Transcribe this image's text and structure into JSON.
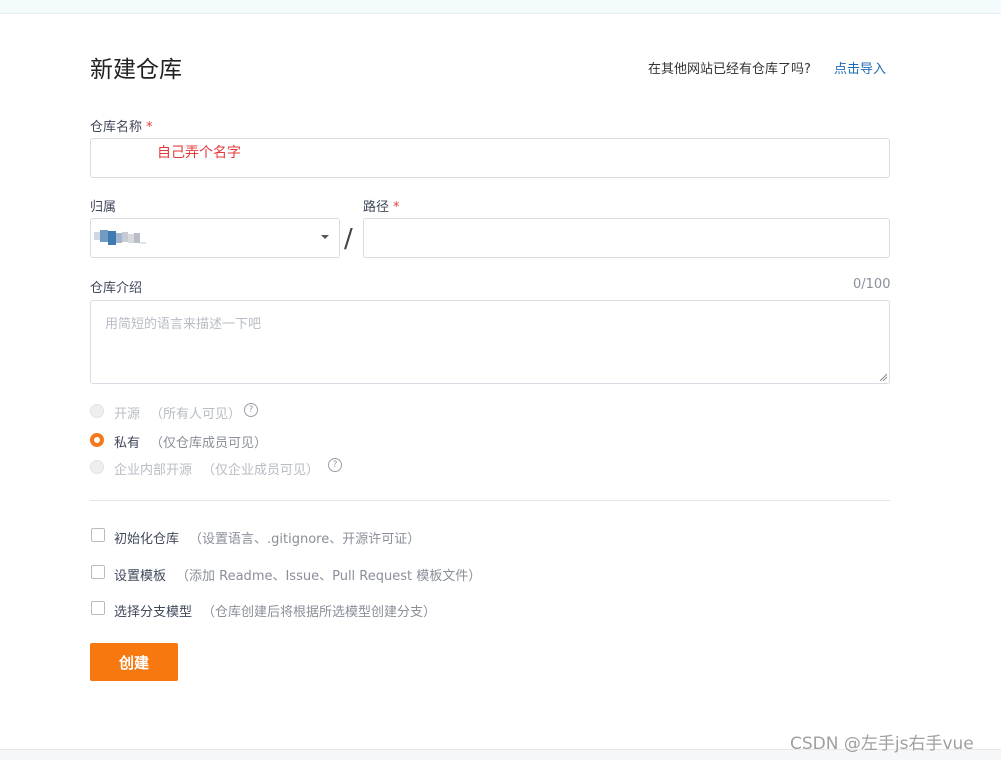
{
  "page_title": "新建仓库",
  "import": {
    "question": "在其他网站已经有仓库了吗?",
    "link": "点击导入"
  },
  "form": {
    "name": {
      "label": "仓库名称",
      "required_mark": "*",
      "value": "自己弄个名字"
    },
    "owner": {
      "label": "归属"
    },
    "separator": "/",
    "path": {
      "label": "路径",
      "required_mark": "*",
      "value": ""
    },
    "description": {
      "label": "仓库介绍",
      "counter": "0/100",
      "placeholder": "用简短的语言来描述一下吧"
    }
  },
  "visibility": [
    {
      "label": "开源",
      "note": "（所有人可见）",
      "checked": false,
      "disabled": true,
      "has_help": true
    },
    {
      "label": "私有",
      "note": "（仅仓库成员可见）",
      "checked": true,
      "disabled": false,
      "has_help": false
    },
    {
      "label": "企业内部开源",
      "note": "（仅企业成员可见）",
      "checked": false,
      "disabled": true,
      "has_help": true
    }
  ],
  "options": [
    {
      "label": "初始化仓库",
      "note": "（设置语言、.gitignore、开源许可证）"
    },
    {
      "label": "设置模板",
      "note": "（添加 Readme、Issue、Pull Request 模板文件）"
    },
    {
      "label": "选择分支模型",
      "note": "（仓库创建后将根据所选模型创建分支）"
    }
  ],
  "create_button": "创建",
  "help_glyph": "?",
  "watermark": "CSDN @左手js右手vue",
  "colors": {
    "accent": "#f6780f",
    "link": "#1f6bb3",
    "required": "#e4393c"
  }
}
